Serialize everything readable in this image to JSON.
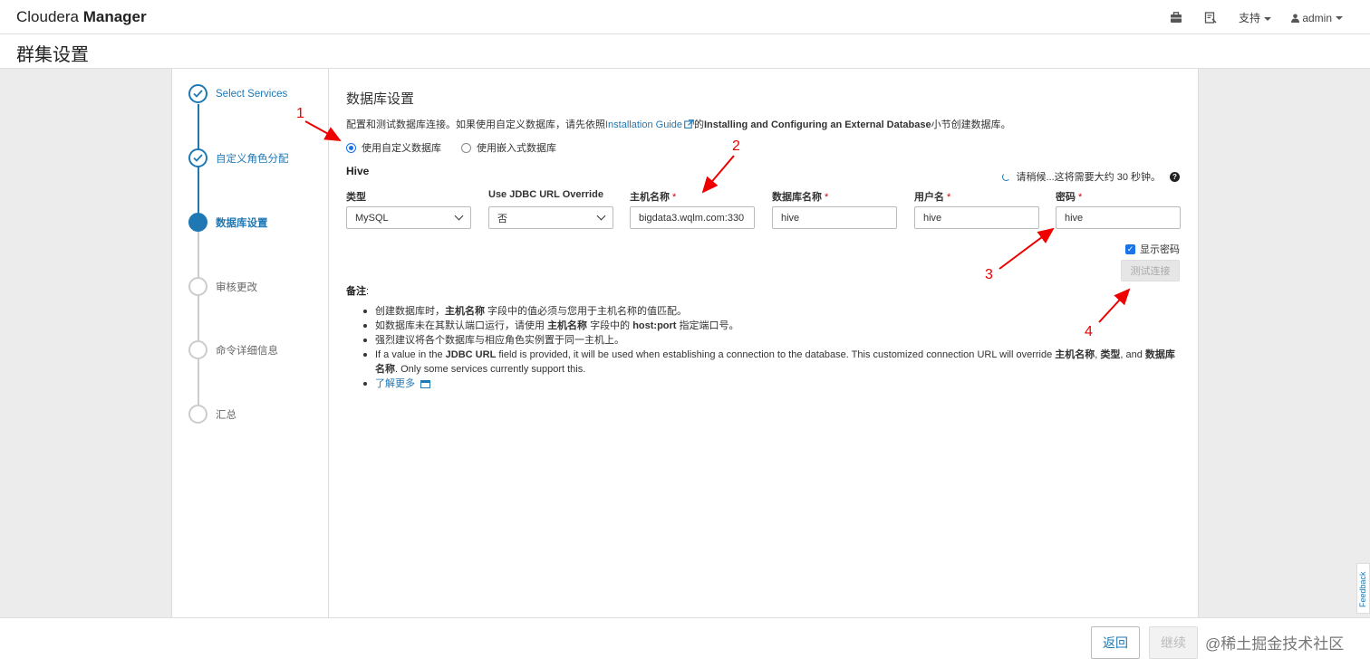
{
  "topbar": {
    "brand_light": "Cloudera ",
    "brand_bold": "Manager",
    "support_label": "支持",
    "user_label": "admin",
    "icons": [
      "briefcase-icon",
      "notes-icon"
    ]
  },
  "page": {
    "title": "群集设置"
  },
  "steps": [
    {
      "label": "Select Services",
      "state": "done"
    },
    {
      "label": "自定义角色分配",
      "state": "done"
    },
    {
      "label": "数据库设置",
      "state": "active"
    },
    {
      "label": "审核更改",
      "state": "pending"
    },
    {
      "label": "命令详细信息",
      "state": "pending"
    },
    {
      "label": "汇总",
      "state": "pending"
    }
  ],
  "main": {
    "section_title": "数据库设置",
    "intro_prefix": "配置和测试数据库连接。如果使用自定义数据库，请先依照",
    "intro_link": "Installation Guide",
    "intro_mid": "的",
    "intro_bold": "Installing and Configuring an External Database",
    "intro_suffix": "小节创建数据库。",
    "radio_custom": "使用自定义数据库",
    "radio_embedded": "使用嵌入式数据库",
    "radio_selected": "custom",
    "service_name": "Hive",
    "wait_text": "请稍候...这将需要大约 30 秒钟。",
    "fields": {
      "type_label": "类型",
      "type_value": "MySQL",
      "jdbc_label": "Use JDBC URL Override",
      "jdbc_value": "否",
      "host_label": "主机名称",
      "host_value": "bigdata3.wqlm.com:330",
      "dbname_label": "数据库名称",
      "dbname_value": "hive",
      "user_label": "用户名",
      "user_value": "hive",
      "pwd_label": "密码",
      "pwd_value": "hive",
      "required_mark": "*"
    },
    "show_password_label": "显示密码",
    "show_password_checked": true,
    "test_button": "测试连接",
    "notes_title": "备注",
    "notes_colon": ":",
    "notes": {
      "n1_a": "创建数据库时，",
      "n1_b": "主机名称",
      "n1_c": " 字段中的值必须与您用于主机名称的值匹配。",
      "n2_a": "如数据库未在其默认端口运行，请使用 ",
      "n2_b": "主机名称",
      "n2_c": " 字段中的 ",
      "n2_d": "host:port",
      "n2_e": " 指定端口号。",
      "n3": "强烈建议将各个数据库与相应角色实例置于同一主机上。",
      "n4_a": "If a value in the ",
      "n4_b": "JDBC URL",
      "n4_c": " field is provided, it will be used when establishing a connection to the database. This customized connection URL will override ",
      "n4_d": "主机名称",
      "n4_e": ", ",
      "n4_f": "类型",
      "n4_g": ", and ",
      "n4_h": "数据库名称",
      "n4_i": ". Only some services currently support this.",
      "learn_more": "了解更多"
    }
  },
  "footer": {
    "back_button": "返回",
    "next_button": "继续",
    "watermark": "@稀土掘金技术社区",
    "feedback": "Feedback"
  },
  "annotations": [
    "1",
    "2",
    "3",
    "4"
  ],
  "colors": {
    "accent": "#1f78b4",
    "annotation": "#e00000",
    "required": "#cc0000"
  }
}
